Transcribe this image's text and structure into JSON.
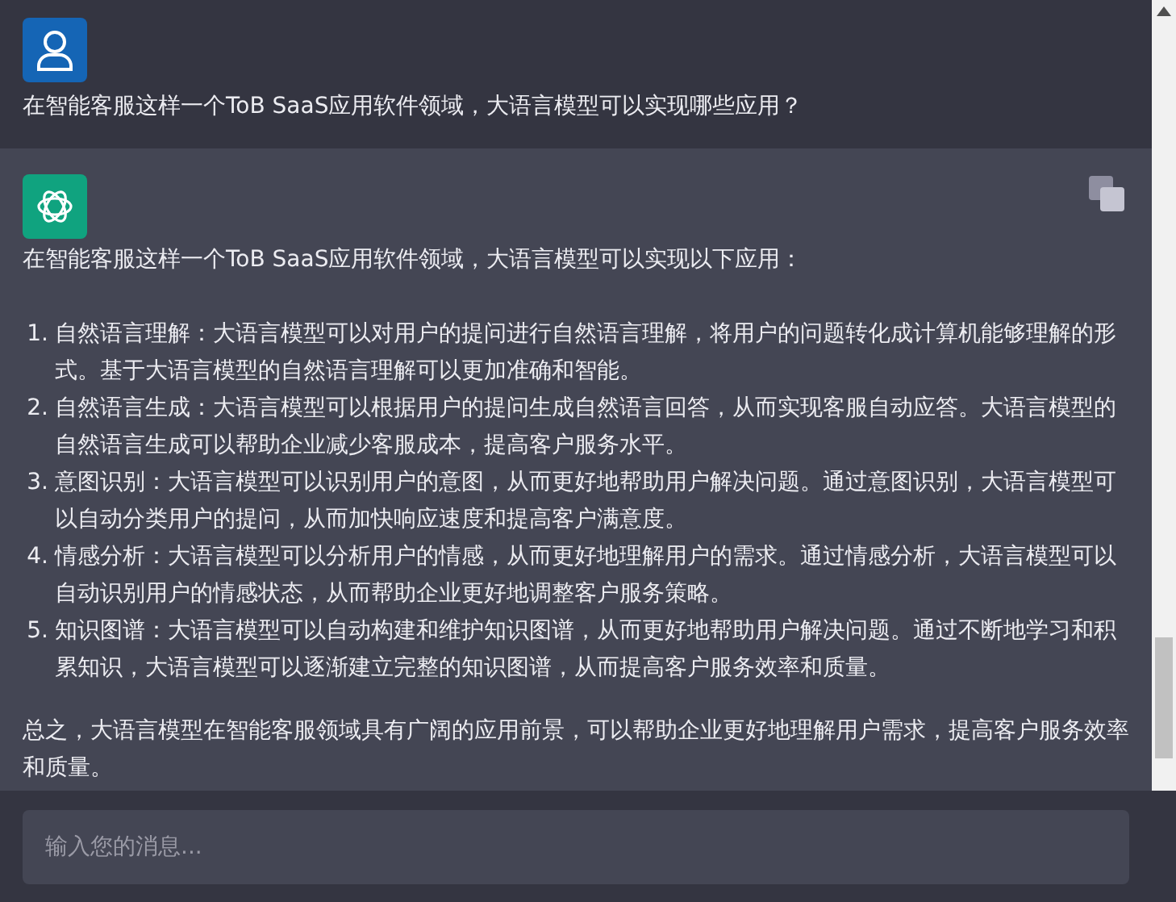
{
  "user_message": {
    "text": "在智能客服这样一个ToB SaaS应用软件领域，大语言模型可以实现哪些应用？"
  },
  "assistant_message": {
    "intro": "在智能客服这样一个ToB SaaS应用软件领域，大语言模型可以实现以下应用：",
    "items": [
      {
        "number": "1.",
        "text": "自然语言理解：大语言模型可以对用户的提问进行自然语言理解，将用户的问题转化成计算机能够理解的形式。基于大语言模型的自然语言理解可以更加准确和智能。"
      },
      {
        "number": "2.",
        "text": "自然语言生成：大语言模型可以根据用户的提问生成自然语言回答，从而实现客服自动应答。大语言模型的自然语言生成可以帮助企业减少客服成本，提高客户服务水平。"
      },
      {
        "number": "3.",
        "text": "意图识别：大语言模型可以识别用户的意图，从而更好地帮助用户解决问题。通过意图识别，大语言模型可以自动分类用户的提问，从而加快响应速度和提高客户满意度。"
      },
      {
        "number": "4.",
        "text": "情感分析：大语言模型可以分析用户的情感，从而更好地理解用户的需求。通过情感分析，大语言模型可以自动识别用户的情感状态，从而帮助企业更好地调整客户服务策略。"
      },
      {
        "number": "5.",
        "text": "知识图谱：大语言模型可以自动构建和维护知识图谱，从而更好地帮助用户解决问题。通过不断地学习和积累知识，大语言模型可以逐渐建立完整的知识图谱，从而提高客户服务效率和质量。"
      }
    ],
    "conclusion": "总之，大语言模型在智能客服领域具有广阔的应用前景，可以帮助企业更好地理解用户需求，提高客户服务效率和质量。"
  },
  "input": {
    "placeholder": "输入您的消息..."
  }
}
